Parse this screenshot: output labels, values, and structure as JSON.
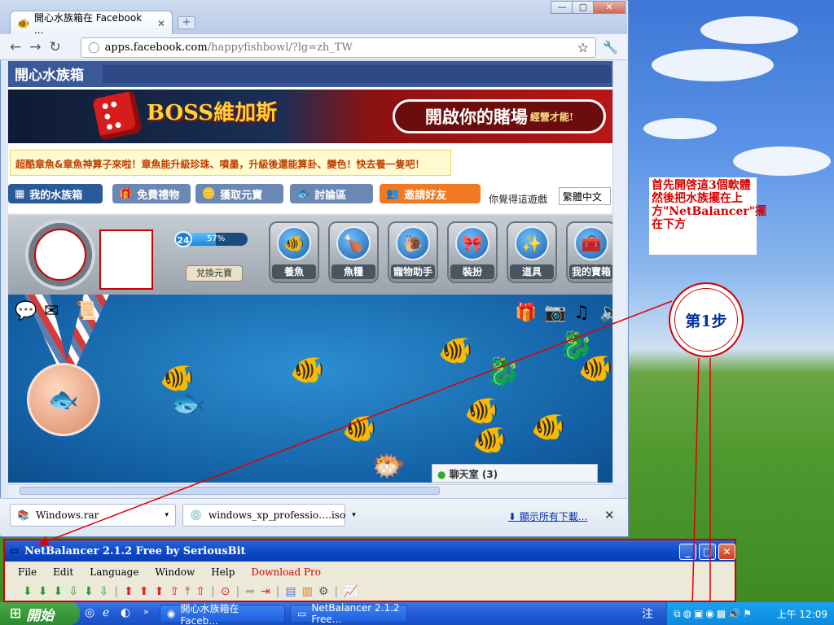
{
  "browser": {
    "tab_title": "開心水族箱在 Facebook ...",
    "tab_close": "✕",
    "new_tab": "+",
    "window_controls": [
      "—",
      "▢",
      "✕"
    ],
    "nav": {
      "back": "←",
      "forward": "→",
      "reload": "↻"
    },
    "url_host": "apps.facebook.com",
    "url_path": "/happyfishbowl/?lg=zh_TW",
    "star": "☆",
    "wrench": "🔧"
  },
  "game": {
    "logo": "開心水族箱",
    "banner_boss": "BOSS維加斯",
    "casino_button": "開啟你的賭場",
    "casino_sub": "經營才能!",
    "notice": "超酷章魚&章魚神算子來啦！章魚能升級珍珠、噴墨，升級後還能算卦、變色！快去養一隻吧！",
    "menu": [
      {
        "label": "我的水族箱",
        "icon": "▦",
        "color": "#2a5a9a"
      },
      {
        "label": "免費禮物",
        "icon": "🎁",
        "color": "#6a88b3"
      },
      {
        "label": "獲取元寶",
        "icon": "🪙",
        "color": "#6a88b3"
      },
      {
        "label": "討論區",
        "icon": "🐟",
        "color": "#6a88b3"
      },
      {
        "label": "邀請好友",
        "icon": "👥",
        "color": "#f07a22"
      }
    ],
    "prompt": "你覺得這遊戲",
    "language": "繁體中文",
    "level": "24",
    "level_progress_percent": 57,
    "level_progress_text": "57%",
    "exchange": "兌換元寶",
    "icon_buttons": [
      {
        "label": "養魚",
        "icon": "🐠"
      },
      {
        "label": "魚糧",
        "icon": "🍗"
      },
      {
        "label": "寵物助手",
        "icon": "🐌"
      },
      {
        "label": "裝扮",
        "icon": "🎀"
      },
      {
        "label": "道具",
        "icon": "✨"
      },
      {
        "label": "我的寶箱",
        "icon": "🧰"
      }
    ],
    "chat_room": "聊天室 (3)"
  },
  "downloads": {
    "items": [
      {
        "name": "Windows.rar",
        "icon": "📚"
      },
      {
        "name": "windows_xp_professio….iso",
        "icon": "💿"
      }
    ],
    "show_all": "顯示所有下載...",
    "close": "✕"
  },
  "annotation": {
    "note": "首先開啓這3個軟體然後把水族擺在上方\"NetBalancer\"擺在下方",
    "step": "第1步"
  },
  "netbalancer": {
    "title": "NetBalancer 2.1.2 Free by SeriousBit",
    "menu": [
      "File",
      "Edit",
      "Language",
      "Window",
      "Help",
      "Download Pro"
    ],
    "download_pro_color": "#cc0000"
  },
  "taskbar": {
    "start": "開始",
    "tasks": [
      "開心水族箱在 Faceb...",
      "NetBalancer 2.1.2 Free..."
    ],
    "ime": "注",
    "clock": "上午 12:09"
  }
}
